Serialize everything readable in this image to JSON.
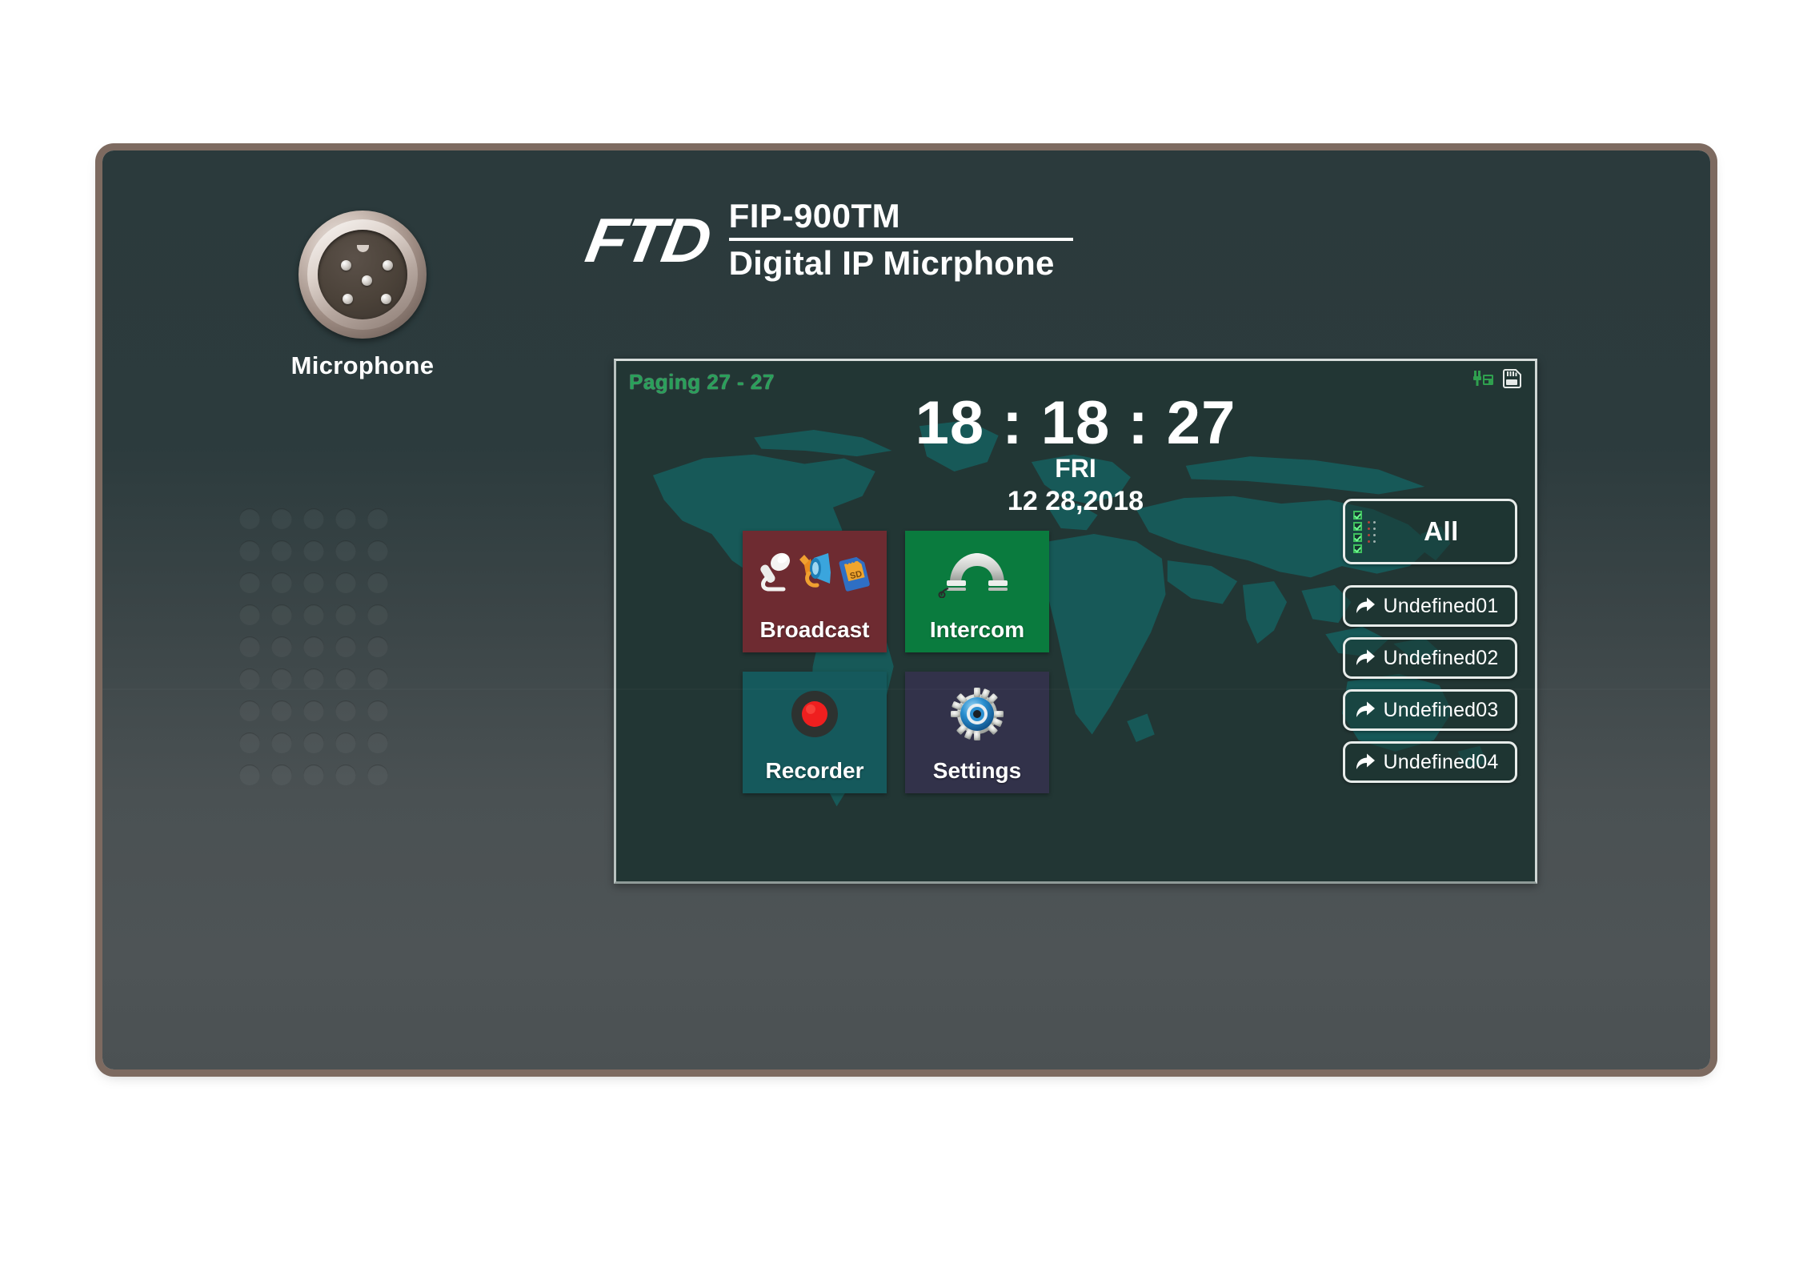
{
  "device": {
    "brand_logo": "FTD",
    "model_name": "FIP-900TM",
    "model_subtitle": "Digital IP Micrphone",
    "mic_connector_label": "Microphone",
    "chassis_color": "#2b3a3c",
    "bezel_color": "#7d6a60"
  },
  "screen": {
    "background_color": "#223634",
    "map_color": "#16605f",
    "status_bar": {
      "paging_label": "Paging 27 - 27",
      "paging_color": "#29a05a",
      "icons": [
        {
          "name": "network-plug-icon",
          "color": "#2fa04e"
        },
        {
          "name": "sd-card-icon",
          "color": "#e6eae8"
        }
      ]
    },
    "clock": {
      "time": "18 : 18 : 27",
      "weekday": "FRI",
      "date": "12 28,2018"
    },
    "tiles": [
      {
        "id": "broadcast",
        "label": "Broadcast",
        "color": "#6e2b31",
        "icons": [
          "microphone-icon",
          "speaker-horn-icon",
          "sd-card-icon"
        ]
      },
      {
        "id": "intercom",
        "label": "Intercom",
        "color": "#0a7b3e",
        "icons": [
          "telephone-handset-icon"
        ]
      },
      {
        "id": "recorder",
        "label": "Recorder",
        "color": "#15595c",
        "icons": [
          "record-dot-icon"
        ]
      },
      {
        "id": "settings",
        "label": "Settings",
        "color": "#32324a",
        "icons": [
          "gear-icon"
        ]
      }
    ],
    "side_buttons": {
      "all": {
        "label": "All",
        "icon": "checklist-icon"
      },
      "zones": [
        {
          "label": "Undefined01",
          "icon": "forward-arrow-icon"
        },
        {
          "label": "Undefined02",
          "icon": "forward-arrow-icon"
        },
        {
          "label": "Undefined03",
          "icon": "forward-arrow-icon"
        },
        {
          "label": "Undefined04",
          "icon": "forward-arrow-icon"
        }
      ]
    }
  }
}
